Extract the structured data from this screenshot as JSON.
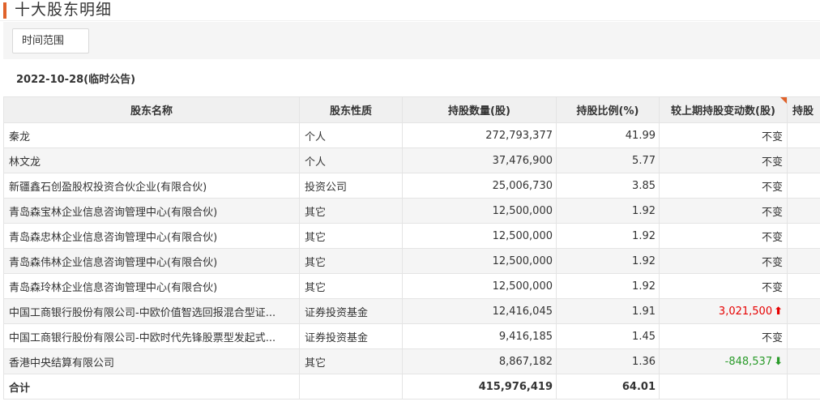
{
  "section": {
    "title": "十大股东明细",
    "time_filter_label": "时间范围",
    "report_date": "2022-10-28(临时公告)"
  },
  "table": {
    "headers": [
      "股东名称",
      "股东性质",
      "持股数量(股)",
      "持股比例(%)",
      "较上期持股变动数(股)",
      "持股"
    ],
    "rows": [
      {
        "name": "秦龙",
        "type": "个人",
        "shares": "272,793,377",
        "ratio": "41.99",
        "change": "不变",
        "trend": "none"
      },
      {
        "name": "林文龙",
        "type": "个人",
        "shares": "37,476,900",
        "ratio": "5.77",
        "change": "不变",
        "trend": "none"
      },
      {
        "name": "新疆鑫石创盈股权投资合伙企业(有限合伙)",
        "type": "投资公司",
        "shares": "25,006,730",
        "ratio": "3.85",
        "change": "不变",
        "trend": "none"
      },
      {
        "name": "青岛森宝林企业信息咨询管理中心(有限合伙)",
        "type": "其它",
        "shares": "12,500,000",
        "ratio": "1.92",
        "change": "不变",
        "trend": "none"
      },
      {
        "name": "青岛森忠林企业信息咨询管理中心(有限合伙)",
        "type": "其它",
        "shares": "12,500,000",
        "ratio": "1.92",
        "change": "不变",
        "trend": "none"
      },
      {
        "name": "青岛森伟林企业信息咨询管理中心(有限合伙)",
        "type": "其它",
        "shares": "12,500,000",
        "ratio": "1.92",
        "change": "不变",
        "trend": "none"
      },
      {
        "name": "青岛森玲林企业信息咨询管理中心(有限合伙)",
        "type": "其它",
        "shares": "12,500,000",
        "ratio": "1.92",
        "change": "不变",
        "trend": "none"
      },
      {
        "name": "中国工商银行股份有限公司-中欧价值智选回报混合型证...",
        "type": "证券投资基金",
        "shares": "12,416,045",
        "ratio": "1.91",
        "change": "3,021,500",
        "trend": "up"
      },
      {
        "name": "中国工商银行股份有限公司-中欧时代先锋股票型发起式...",
        "type": "证券投资基金",
        "shares": "9,416,185",
        "ratio": "1.45",
        "change": "不变",
        "trend": "none"
      },
      {
        "name": "香港中央结算有限公司",
        "type": "其它",
        "shares": "8,867,182",
        "ratio": "1.36",
        "change": "-848,537",
        "trend": "down"
      }
    ],
    "total": {
      "label": "合计",
      "shares": "415,976,419",
      "ratio": "64.01"
    }
  },
  "colors": {
    "accent": "#e0622a",
    "up": "#e60000",
    "down": "#2a9b2a"
  }
}
